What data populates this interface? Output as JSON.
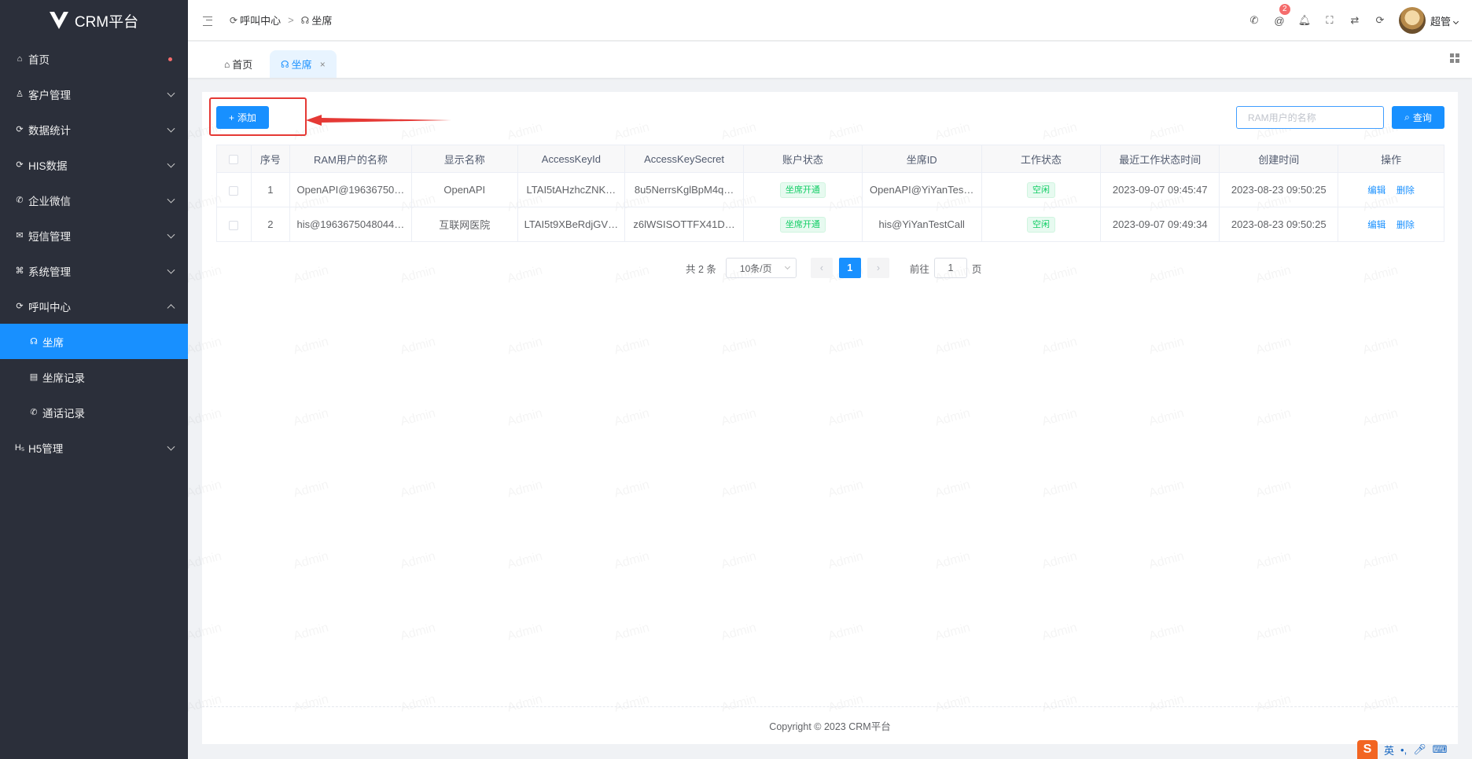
{
  "app": {
    "title": "CRM平台"
  },
  "sidebar": {
    "items": [
      {
        "label": "首页",
        "icon": "home-icon",
        "glyph": "⌂",
        "has_dot": true
      },
      {
        "label": "客户管理",
        "icon": "user-icon",
        "glyph": "♙",
        "expandable": true
      },
      {
        "label": "数据统计",
        "icon": "chart-icon",
        "glyph": "⟳",
        "expandable": true
      },
      {
        "label": "HIS数据",
        "icon": "data-icon",
        "glyph": "⟳",
        "expandable": true
      },
      {
        "label": "企业微信",
        "icon": "wechat-icon",
        "glyph": "✆",
        "expandable": true
      },
      {
        "label": "短信管理",
        "icon": "message-icon",
        "glyph": "✉",
        "expandable": true
      },
      {
        "label": "系统管理",
        "icon": "command-icon",
        "glyph": "⌘",
        "expandable": true
      },
      {
        "label": "呼叫中心",
        "icon": "callcenter-icon",
        "glyph": "⟳",
        "expanded": true
      },
      {
        "label": "坐席",
        "icon": "headset-icon",
        "glyph": "☊",
        "sub": true,
        "active": true
      },
      {
        "label": "坐席记录",
        "icon": "clipboard-icon",
        "glyph": "▤",
        "sub": true
      },
      {
        "label": "通话记录",
        "icon": "phone-icon",
        "glyph": "✆",
        "sub": true
      },
      {
        "label": "H5管理",
        "icon": "h5-icon",
        "glyph": "H₅",
        "expandable": true
      }
    ]
  },
  "header": {
    "breadcrumb": [
      "呼叫中心",
      "坐席"
    ],
    "breadcrumb_sep": ">",
    "notification_count": "2",
    "username": "超管"
  },
  "tabs": [
    {
      "label": "首页"
    },
    {
      "label": "坐席",
      "close": "×"
    }
  ],
  "toolbar": {
    "add_label": "添加",
    "add_icon": "+",
    "search_placeholder": "RAM用户的名称",
    "query_label": "查询"
  },
  "table": {
    "columns": [
      "序号",
      "RAM用户的名称",
      "显示名称",
      "AccessKeyId",
      "AccessKeySecret",
      "账户状态",
      "坐席ID",
      "工作状态",
      "最近工作状态时间",
      "创建时间",
      "操作"
    ],
    "rows": [
      {
        "index": "1",
        "ram_user": "OpenAPI@19636750…",
        "display_name": "OpenAPI",
        "access_key_id": "LTAI5tAHzhcZNK…",
        "access_key_secret": "8u5NerrsKglBpM4q…",
        "account_status": "坐席开通",
        "agent_id": "OpenAPI@YiYanTes…",
        "work_status": "空闲",
        "last_status_time": "2023-09-07 09:45:47",
        "created_time": "2023-08-23 09:50:25",
        "edit": "编辑",
        "delete": "删除"
      },
      {
        "index": "2",
        "ram_user": "his@1963675048044…",
        "display_name": "互联网医院",
        "access_key_id": "LTAI5t9XBeRdjGV…",
        "access_key_secret": "z6lWSISOTTFX41D…",
        "account_status": "坐席开通",
        "agent_id": "his@YiYanTestCall",
        "work_status": "空闲",
        "last_status_time": "2023-09-07 09:49:34",
        "created_time": "2023-08-23 09:50:25",
        "edit": "编辑",
        "delete": "删除"
      }
    ]
  },
  "pagination": {
    "total_text": "共 2 条",
    "page_size": "10条/页",
    "current_page": "1",
    "goto_label": "前往",
    "goto_value": "1",
    "page_suffix": "页"
  },
  "watermark_text": "Admin",
  "footer": {
    "text": "Copyright © 2023 CRM平台"
  },
  "ime": {
    "logo": "S",
    "mode": "英",
    "punct": "•,"
  },
  "colors": {
    "sidebar_bg": "#2b2f3a",
    "accent": "#1890ff",
    "highlight_red": "#e53935",
    "tag_green": "#13ce66"
  }
}
